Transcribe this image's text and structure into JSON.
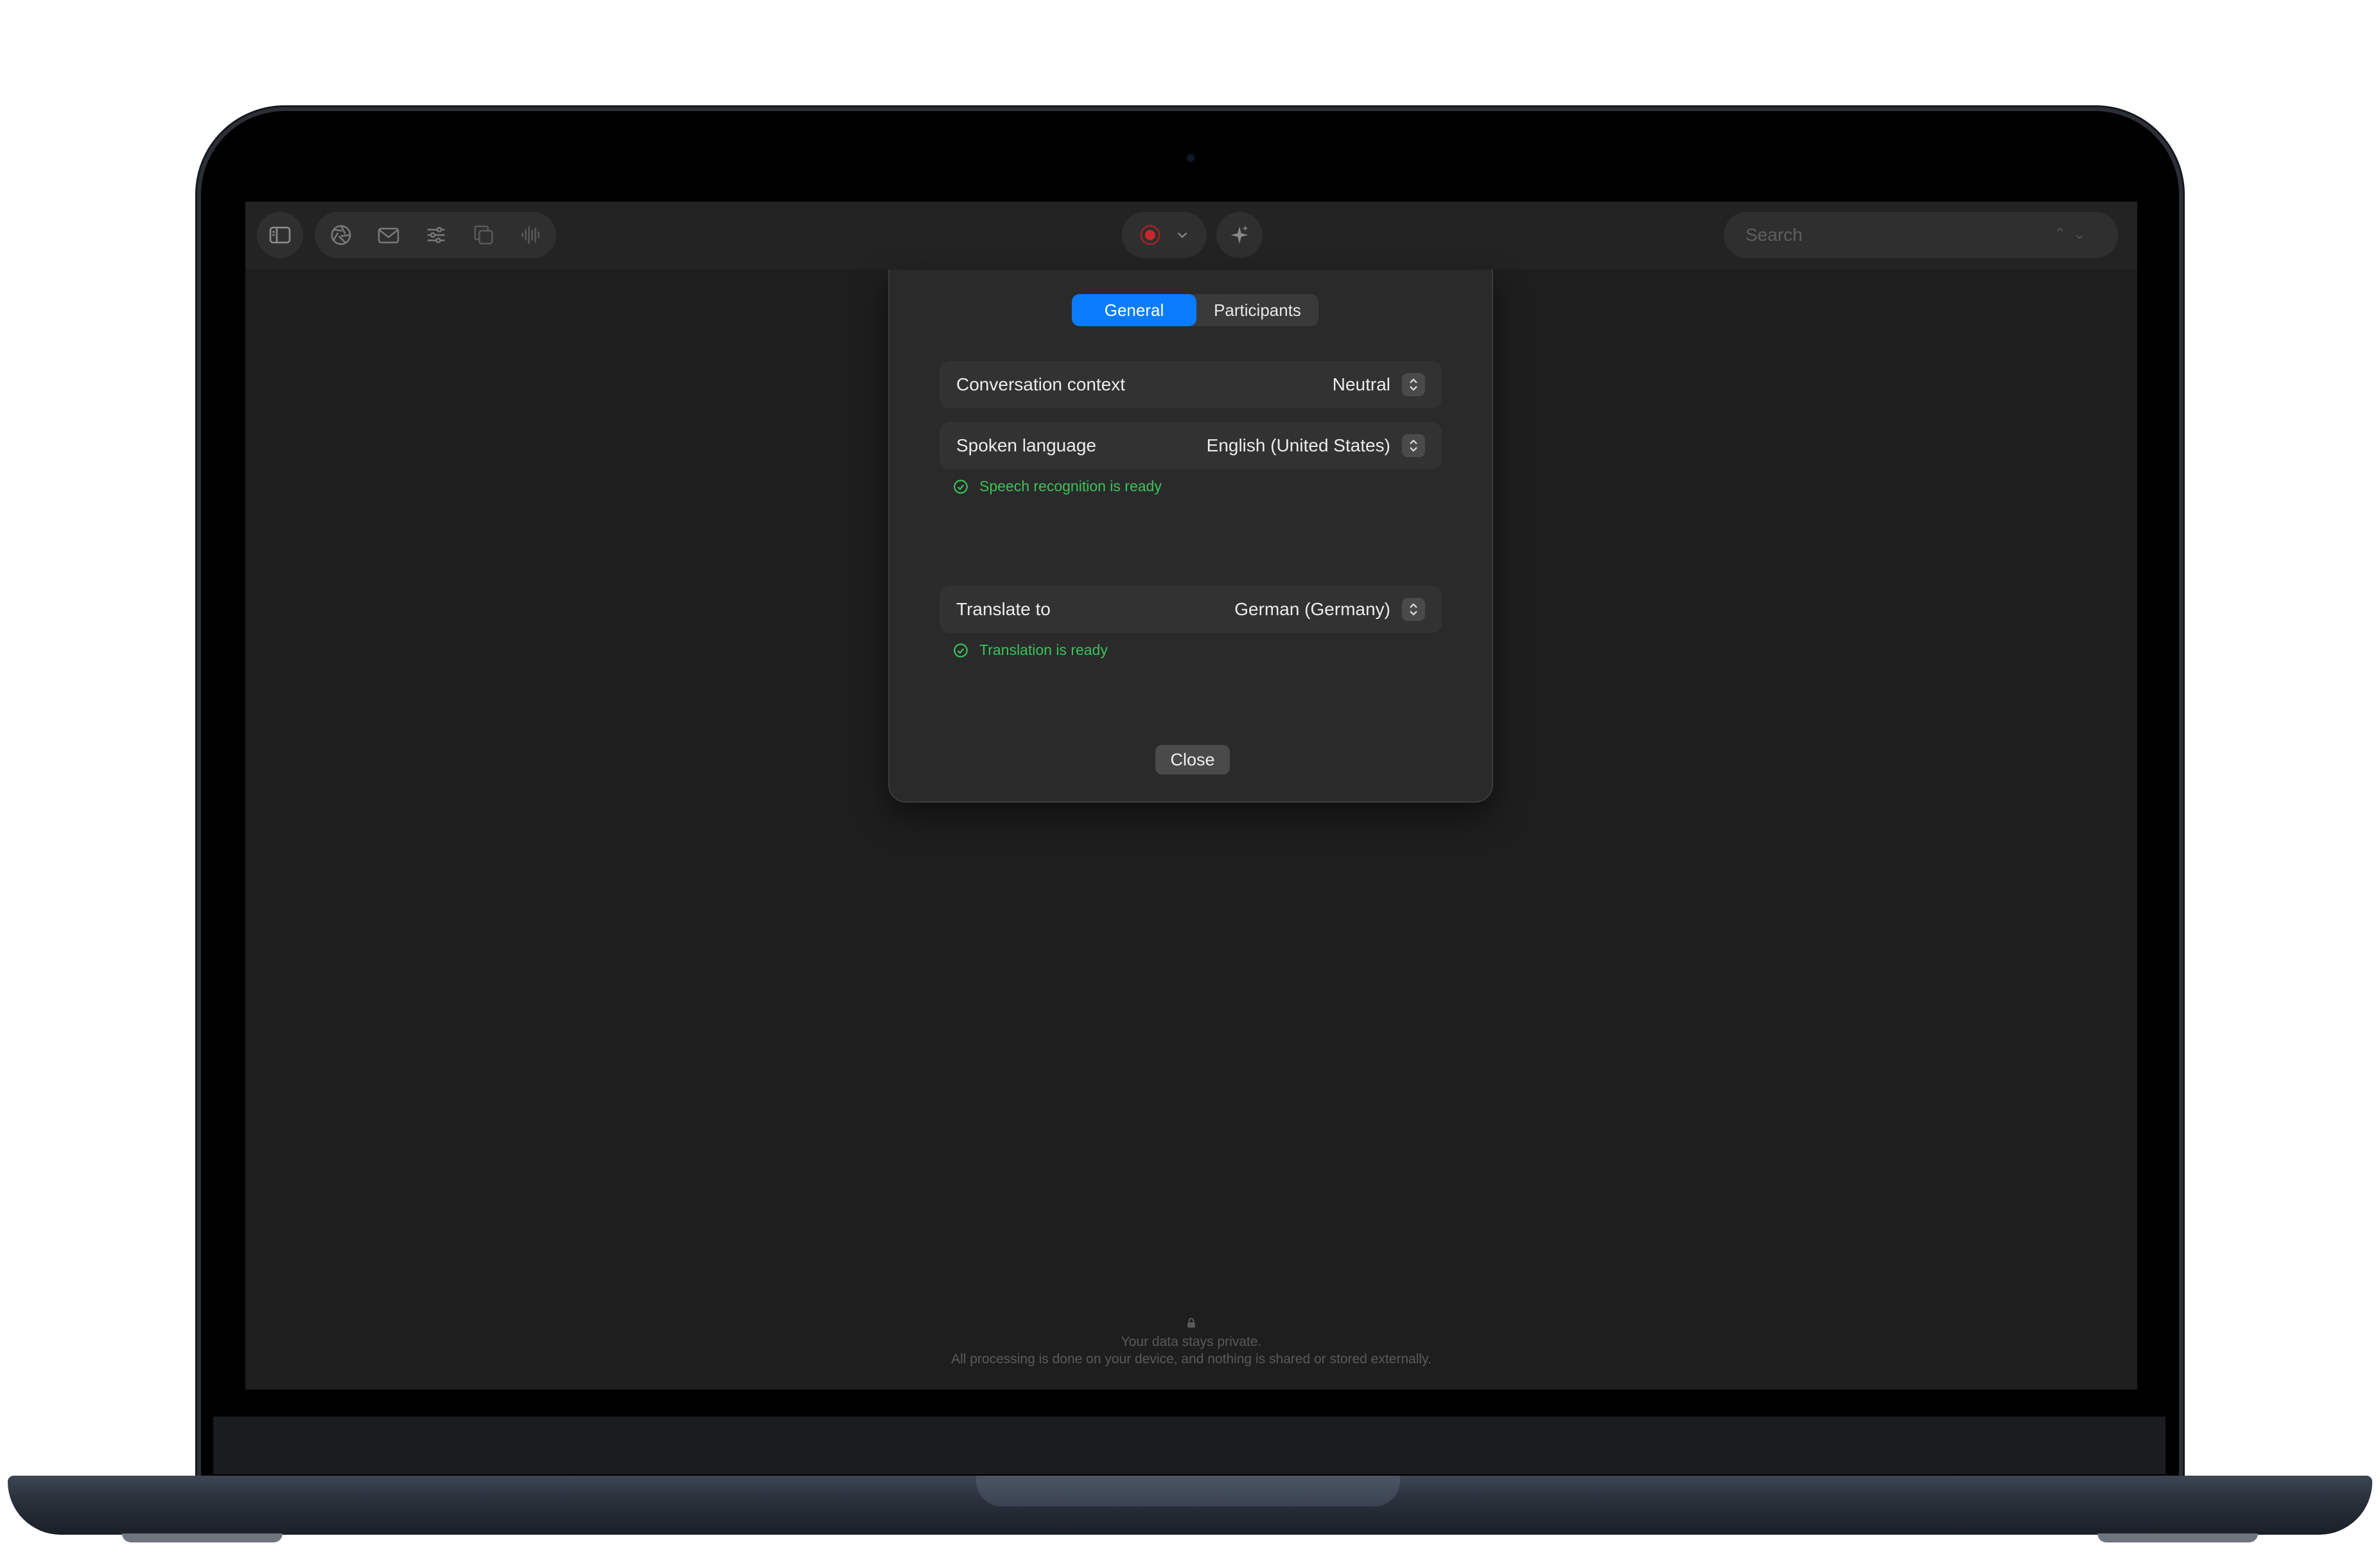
{
  "toolbar": {
    "left_icons": [
      "sidebar-icon",
      "aperture-icon",
      "envelope-icon",
      "sliders-icon",
      "copy-icon",
      "waveform-icon"
    ],
    "record_icons": [
      "record-icon",
      "chevron-down-icon"
    ],
    "sparkle_icon": "sparkle-icon",
    "search": {
      "placeholder": "Search"
    }
  },
  "dialog": {
    "tabs": [
      {
        "label": "General",
        "selected": true
      },
      {
        "label": "Participants",
        "selected": false
      }
    ],
    "rows": [
      {
        "label": "Conversation context",
        "value": "Neutral"
      },
      {
        "label": "Spoken language",
        "value": "English (United States)"
      },
      {
        "label": "Translate to",
        "value": "German (Germany)"
      }
    ],
    "statuses": [
      {
        "text": "Speech recognition is ready"
      },
      {
        "text": "Translation is ready"
      }
    ],
    "close_label": "Close"
  },
  "privacy": {
    "line1": "Your data stays private.",
    "line2": "All processing is done on your device, and nothing is shared or stored externally."
  },
  "colors": {
    "accent": "#0a7cff",
    "status_ok": "#3cc25b",
    "record": "#c9282d",
    "window_bg": "#1e1e1e"
  }
}
